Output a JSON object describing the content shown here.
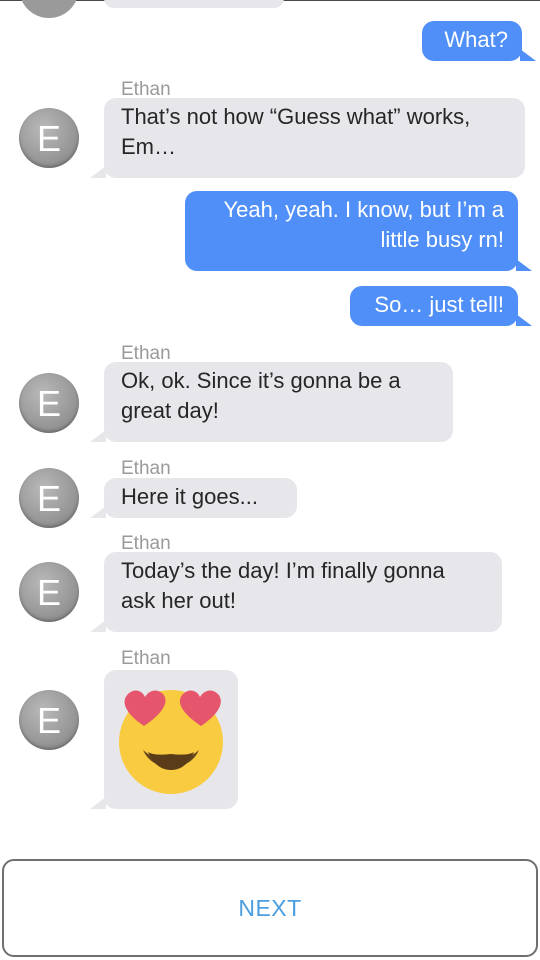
{
  "contact": {
    "name": "Ethan",
    "avatar_letter": "E"
  },
  "messages": [
    {
      "from": "me",
      "text": "What?"
    },
    {
      "from": "ethan",
      "sender": "Ethan",
      "lines": [
        "That’s not how “Guess what” works,",
        "Em…"
      ]
    },
    {
      "from": "me",
      "lines": [
        "Yeah, yeah. I know, but I’m a",
        "little busy rn!"
      ]
    },
    {
      "from": "me",
      "text": "So… just tell!"
    },
    {
      "from": "ethan",
      "sender": "Ethan",
      "lines": [
        "Ok, ok. Since it’s gonna be a",
        "great day!"
      ]
    },
    {
      "from": "ethan",
      "sender": "Ethan",
      "text": "Here it goes..."
    },
    {
      "from": "ethan",
      "sender": "Ethan",
      "lines": [
        "Today’s the day! I’m finally gonna",
        "ask her out!"
      ]
    },
    {
      "from": "ethan",
      "sender": "Ethan",
      "emoji": "smiling-face-with-heart-eyes"
    }
  ],
  "next_button": {
    "label": "NEXT"
  },
  "colors": {
    "outgoing_bubble": "#4f8ff7",
    "incoming_bubble": "#e6e6eb",
    "button_text": "#4a9ee0"
  }
}
